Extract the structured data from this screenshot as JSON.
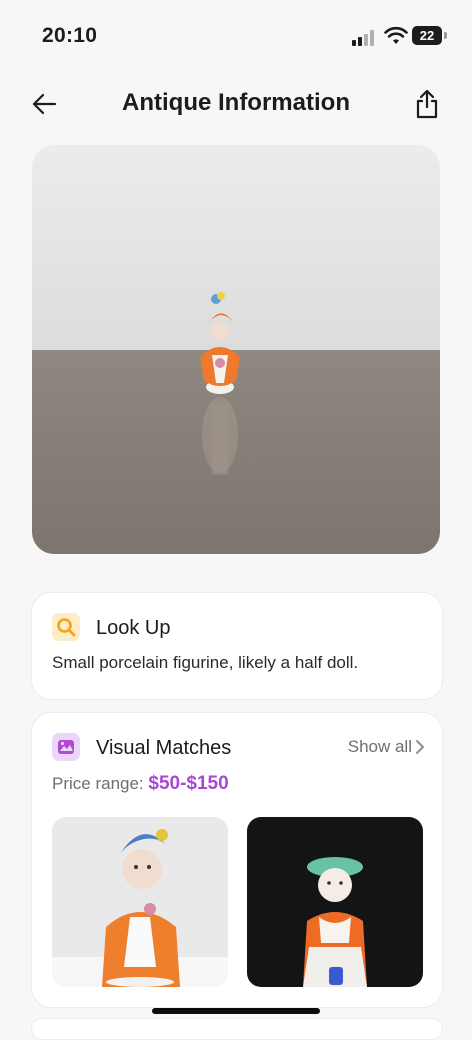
{
  "status_bar": {
    "time": "20:10",
    "battery": "22"
  },
  "nav": {
    "title": "Antique Information"
  },
  "lookup": {
    "title": "Look Up",
    "description": "Small porcelain figurine, likely a half doll."
  },
  "matches": {
    "title": "Visual Matches",
    "show_all": "Show all",
    "price_label": "Price range: ",
    "price_value": "$50-$150"
  },
  "colors": {
    "accent": "#a946d6",
    "lookup_badge": "#fdecc8",
    "matches_badge": "#ecd6f8"
  },
  "icons": [
    "back-arrow-icon",
    "share-icon",
    "search-icon",
    "gallery-icon",
    "chevron-right-icon",
    "signal-icon",
    "wifi-icon",
    "battery-icon"
  ]
}
